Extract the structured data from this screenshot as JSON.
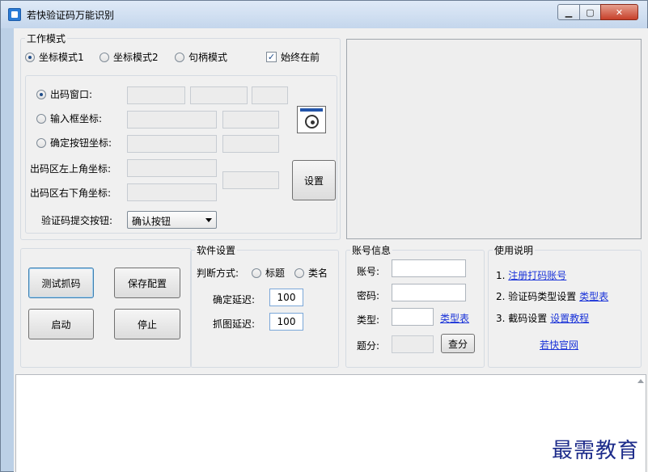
{
  "window": {
    "title": "若快验证码万能识别",
    "controls": [
      "minimize",
      "maximize",
      "close"
    ]
  },
  "work_mode": {
    "title": "工作模式",
    "options": [
      {
        "label": "坐标模式1",
        "selected": true
      },
      {
        "label": "坐标模式2",
        "selected": false
      },
      {
        "label": "句柄模式",
        "selected": false
      }
    ],
    "always_on_top": {
      "label": "始终在前",
      "checked": true
    }
  },
  "coords": {
    "output_window": "出码窗口:",
    "input_coord": "输入框坐标:",
    "confirm_coord": "确定按钮坐标:",
    "area_top_left": "出码区左上角坐标:",
    "area_bottom_right": "出码区右下角坐标:",
    "submit_label": "验证码提交按钮:",
    "submit_value": "确认按钮",
    "set_button": "设置",
    "target_icon": "crosshair-target-icon"
  },
  "actions": {
    "test_capture": "测试抓码",
    "save_config": "保存配置",
    "start": "启动",
    "stop": "停止"
  },
  "software_settings": {
    "title": "软件设置",
    "judge_label": "判断方式:",
    "judge_options": [
      {
        "label": "标题",
        "selected": false
      },
      {
        "label": "类名",
        "selected": false
      }
    ],
    "confirm_delay_label": "确定延迟:",
    "confirm_delay_value": "100",
    "capture_delay_label": "抓图延迟:",
    "capture_delay_value": "100"
  },
  "account": {
    "title": "账号信息",
    "username_label": "账号:",
    "password_label": "密码:",
    "type_label": "类型:",
    "type_link": "类型表",
    "score_label": "题分:",
    "query_button": "查分"
  },
  "help": {
    "title": "使用说明",
    "item1_prefix": "1.",
    "item1_link": "注册打码账号",
    "item2_prefix": "2. 验证码类型设置",
    "item2_link": "类型表",
    "item3_prefix": "3. 截码设置",
    "item3_link": "设置教程",
    "site_link": "若快官网"
  },
  "watermark": "最需教育"
}
